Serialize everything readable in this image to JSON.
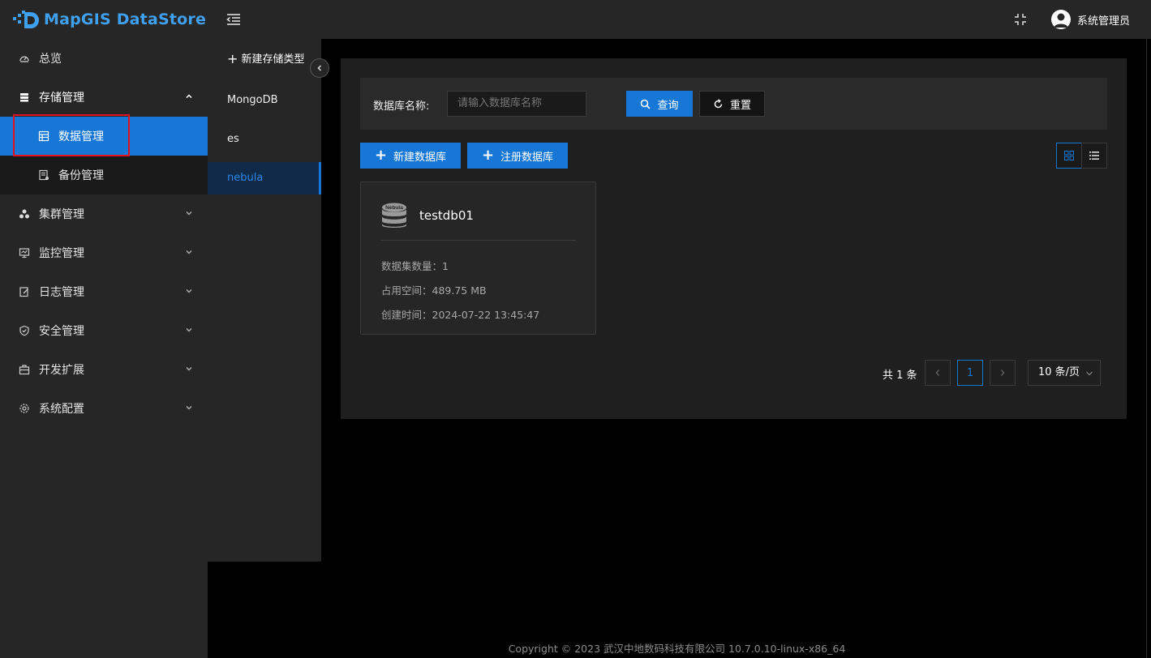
{
  "app": {
    "title": "MapGIS DataStore"
  },
  "sidebar": {
    "items": [
      {
        "label": "总览",
        "icon": "dashboard-icon"
      },
      {
        "label": "存储管理",
        "icon": "storage-icon",
        "expanded": true
      },
      {
        "label": "数据管理",
        "icon": "data-icon",
        "active": true
      },
      {
        "label": "备份管理",
        "icon": "backup-icon"
      },
      {
        "label": "集群管理",
        "icon": "cluster-icon"
      },
      {
        "label": "监控管理",
        "icon": "monitor-icon"
      },
      {
        "label": "日志管理",
        "icon": "log-icon"
      },
      {
        "label": "安全管理",
        "icon": "shield-icon"
      },
      {
        "label": "开发扩展",
        "icon": "extension-icon"
      },
      {
        "label": "系统配置",
        "icon": "gear-icon"
      }
    ]
  },
  "header": {
    "user_name": "系统管理员"
  },
  "storage_types": {
    "new_label": "新建存储类型",
    "items": [
      "MongoDB",
      "es",
      "nebula"
    ],
    "active": "nebula"
  },
  "filter": {
    "label": "数据库名称:",
    "placeholder": "请输入数据库名称",
    "query_label": "查询",
    "reset_label": "重置"
  },
  "actions": {
    "new_db_label": "新建数据库",
    "register_db_label": "注册数据库"
  },
  "card": {
    "icon_label": "Nebula",
    "title": "testdb01",
    "dataset_count": "数据集数量：1",
    "used_space": "占用空间：489.75 MB",
    "created_time": "创建时间：2024-07-22 13:45:47"
  },
  "pagination": {
    "total": "共 1 条",
    "current_page": "1",
    "page_size": "10 条/页"
  },
  "footer": {
    "copyright": "Copyright © 2023 武汉中地数码科技有限公司 10.7.0.10-linux-x86_64"
  },
  "colors": {
    "accent": "#1677d6",
    "highlight_box": "#e0141e",
    "sidebar_bg": "#262626"
  }
}
